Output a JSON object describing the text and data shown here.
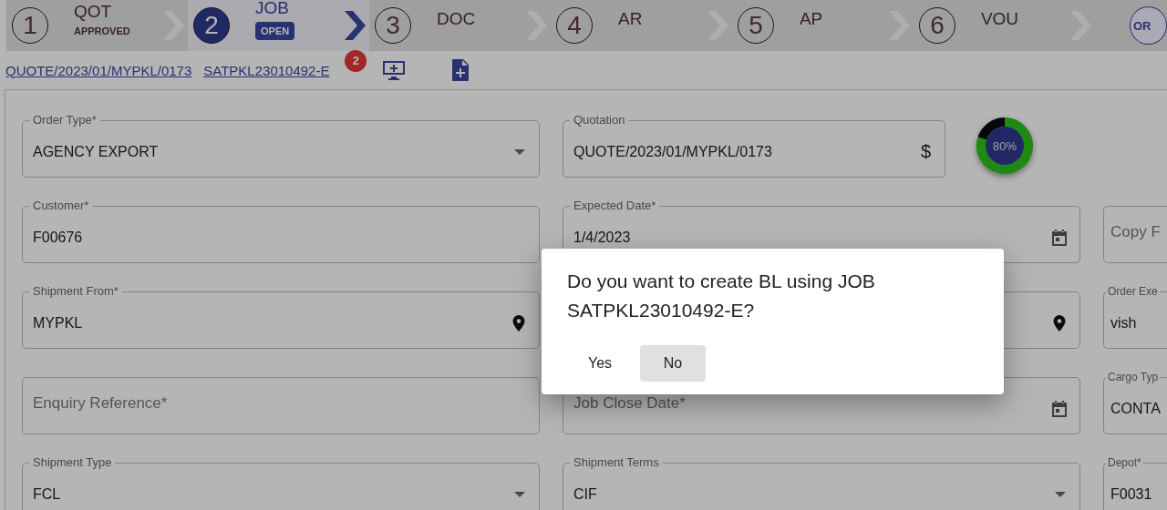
{
  "steps": [
    {
      "number": "1",
      "title": "QOT",
      "sub": "APPROVED",
      "selected": false
    },
    {
      "number": "2",
      "title": "JOB",
      "sub": "OPEN",
      "selected": true
    },
    {
      "number": "3",
      "title": "DOC",
      "selected": false
    },
    {
      "number": "4",
      "title": "AR",
      "selected": false
    },
    {
      "number": "5",
      "title": "AP",
      "selected": false
    },
    {
      "number": "6",
      "title": "VOU",
      "selected": false
    }
  ],
  "avatar_text": "OR",
  "links": [
    {
      "text": "QUOTE/2023/01/MYPKL/0173"
    },
    {
      "text": "SATPKL23010492-E",
      "badge": "2"
    }
  ],
  "toolbar": [
    {
      "kind": "monitor-plus"
    },
    {
      "kind": "file-plus"
    }
  ],
  "progress": {
    "label": "80%",
    "level": 0.8
  },
  "rows": [
    [
      {
        "kind": "select",
        "label": "Order Type*",
        "value": "AGENCY EXPORT"
      },
      {
        "kind": "quotation",
        "label": "Quotation",
        "value": "QUOTE/2023/01/MYPKL/0173",
        "suffix": "$"
      }
    ],
    [
      {
        "kind": "text",
        "label": "Customer*",
        "value": "F00676"
      },
      {
        "kind": "date",
        "label": "Expected Date*",
        "value": "1/4/2023"
      },
      {
        "kind": "text",
        "placeholder": "Copy F"
      }
    ],
    [
      {
        "kind": "location",
        "label": "Shipment From*",
        "value": "MYPKL"
      },
      {
        "kind": "location"
      },
      {
        "kind": "text",
        "label": "Order Exe",
        "value": "vish"
      }
    ],
    [
      {
        "kind": "text",
        "placeholder": "Enquiry Reference*"
      },
      {
        "kind": "date",
        "placeholder": "Job Close Date*"
      },
      {
        "kind": "text",
        "label": "Cargo Typ",
        "value": "CONTA"
      }
    ],
    [
      {
        "kind": "select",
        "label": "Shipment Type",
        "value": "FCL"
      },
      {
        "kind": "select",
        "label": "Shipment Terms",
        "value": "CIF"
      },
      {
        "kind": "text",
        "label": "Depot*",
        "value": "F0031"
      }
    ]
  ],
  "dialog": {
    "message": "Do you want to create BL using JOB SATPKL23010492-E?",
    "buttons": [
      {
        "label": "Yes",
        "focused": false
      },
      {
        "label": "No",
        "focused": true
      }
    ]
  }
}
